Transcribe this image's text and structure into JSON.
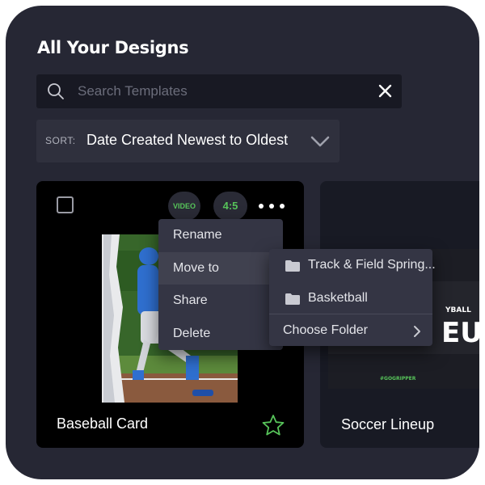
{
  "page": {
    "title": "All Your Designs"
  },
  "search": {
    "placeholder": "Search Templates",
    "icon": "search-icon",
    "clear_icon": "close-icon"
  },
  "sort": {
    "label": "SORT:",
    "value": "Date Created Newest to Oldest",
    "icon": "chevron-down-icon"
  },
  "cards": [
    {
      "name": "Baseball Card",
      "badges": [
        "VIDEO",
        "4:5"
      ],
      "favorite": false,
      "selected": false
    },
    {
      "name": "Soccer Lineup",
      "preview_text": [
        "YBALL",
        "EUP",
        "#GOGRIPPER"
      ]
    }
  ],
  "context_menu": {
    "items": [
      "Rename",
      "Move to",
      "Share",
      "Delete"
    ],
    "active_item": "Move to"
  },
  "move_submenu": {
    "folders": [
      "Track & Field Spring...",
      "Basketball"
    ],
    "choose_folder": "Choose Folder"
  },
  "colors": {
    "background": "#262734",
    "accent": "#57c45a",
    "menu": "#343544"
  }
}
